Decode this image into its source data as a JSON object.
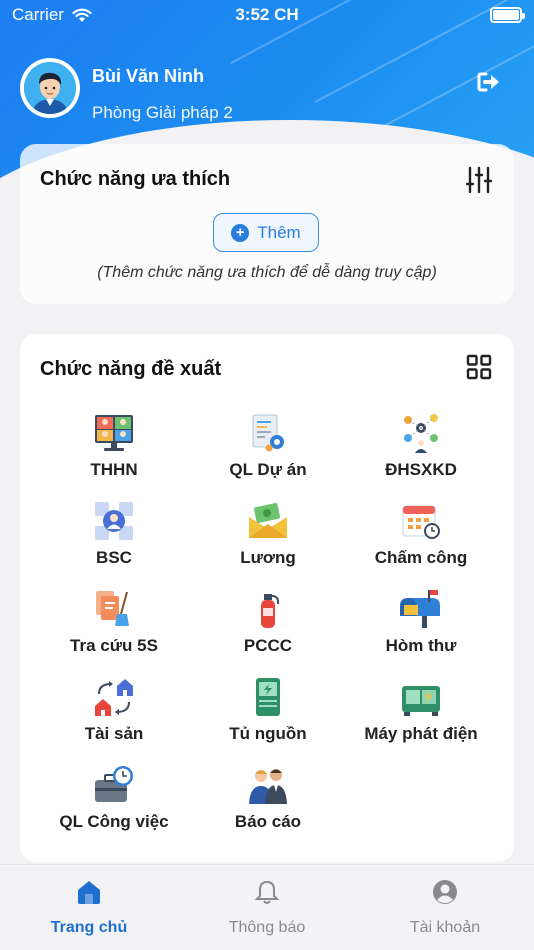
{
  "status_bar": {
    "carrier": "Carrier",
    "time": "3:52 CH"
  },
  "profile": {
    "name": "Bùi Văn Ninh",
    "department": "Phòng Giải pháp 2"
  },
  "favorites": {
    "title": "Chức năng ưa thích",
    "add_label": "Thêm",
    "hint": "(Thêm chức năng ưa thích để dễ dàng truy cập)"
  },
  "suggested": {
    "title": "Chức năng đề xuất",
    "items": [
      {
        "label": "THHN",
        "icon": "video-conference-icon"
      },
      {
        "label": "QL Dự án",
        "icon": "project-document-icon"
      },
      {
        "label": "ĐHSXKD",
        "icon": "business-network-icon"
      },
      {
        "label": "BSC",
        "icon": "bsc-person-icon"
      },
      {
        "label": "Lương",
        "icon": "salary-envelope-icon"
      },
      {
        "label": "Chấm công",
        "icon": "calendar-clock-icon"
      },
      {
        "label": "Tra cứu 5S",
        "icon": "cleaning-documents-icon"
      },
      {
        "label": "PCCC",
        "icon": "fire-extinguisher-icon"
      },
      {
        "label": "Hòm thư",
        "icon": "mailbox-icon"
      },
      {
        "label": "Tài sản",
        "icon": "houses-exchange-icon"
      },
      {
        "label": "Tủ nguồn",
        "icon": "power-cabinet-icon"
      },
      {
        "label": "Máy phát điện",
        "icon": "generator-icon"
      },
      {
        "label": "QL Công việc",
        "icon": "briefcase-clock-icon"
      },
      {
        "label": "Báo cáo",
        "icon": "report-people-icon"
      }
    ]
  },
  "tabs": [
    {
      "label": "Trang chủ",
      "icon": "home-icon",
      "active": true
    },
    {
      "label": "Thông báo",
      "icon": "bell-icon",
      "active": false
    },
    {
      "label": "Tài khoản",
      "icon": "user-circle-icon",
      "active": false
    }
  ],
  "colors": {
    "accent": "#1f6fd0",
    "header": "#1e7ef2"
  }
}
